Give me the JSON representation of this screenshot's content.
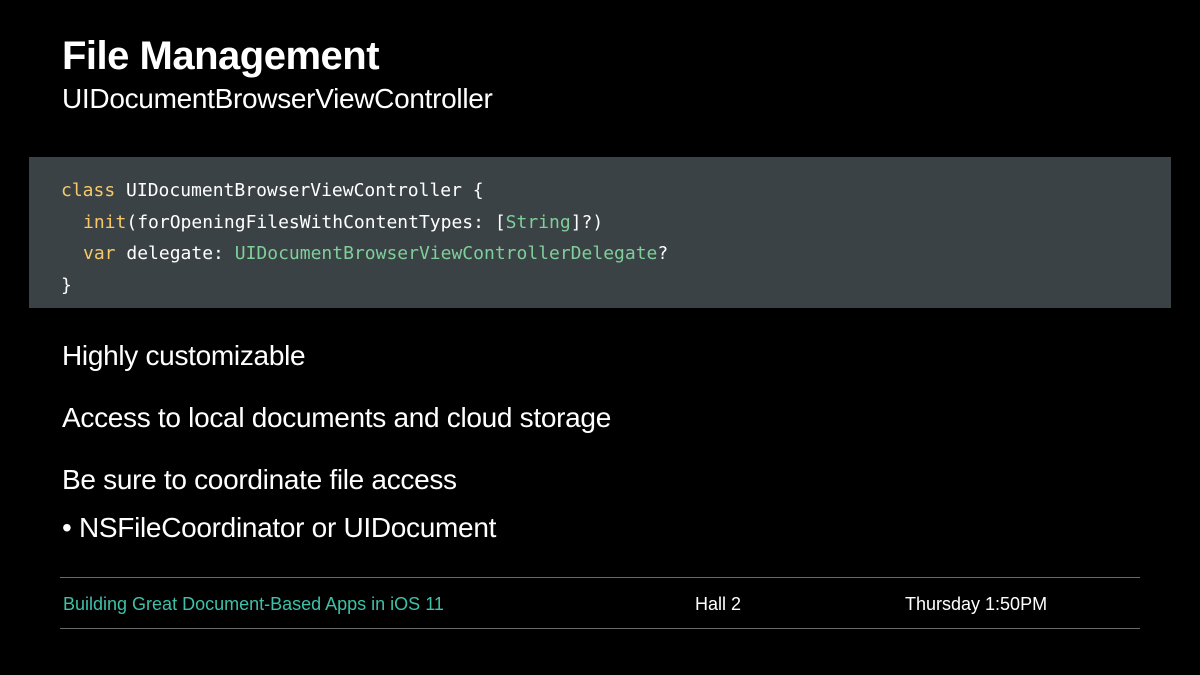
{
  "slide": {
    "title": "File Management",
    "subtitle": "UIDocumentBrowserViewController"
  },
  "code": {
    "line1": {
      "keyword": "class",
      "rest": " UIDocumentBrowserViewController {"
    },
    "line2": {
      "keyword": "init",
      "text_a": "(forOpeningFilesWithContentTypes: [",
      "type": "String",
      "text_b": "]?)"
    },
    "line3": {
      "keyword": "var",
      "text_a": " delegate: ",
      "type": "UIDocumentBrowserViewControllerDelegate",
      "text_b": "?"
    },
    "line4": "}"
  },
  "bullets": [
    "Highly customizable",
    "Access to local documents and cloud storage",
    "Be sure to coordinate file access",
    "• NSFileCoordinator or UIDocument"
  ],
  "footer": {
    "session": "Building Great Document-Based Apps in iOS 11",
    "room": "Hall 2",
    "time": "Thursday 1:50PM"
  },
  "colors": {
    "background": "#000000",
    "code_background": "#3b4245",
    "keyword": "#f5c96a",
    "type": "#7fcf9a",
    "session_link": "#3fc0a8"
  }
}
